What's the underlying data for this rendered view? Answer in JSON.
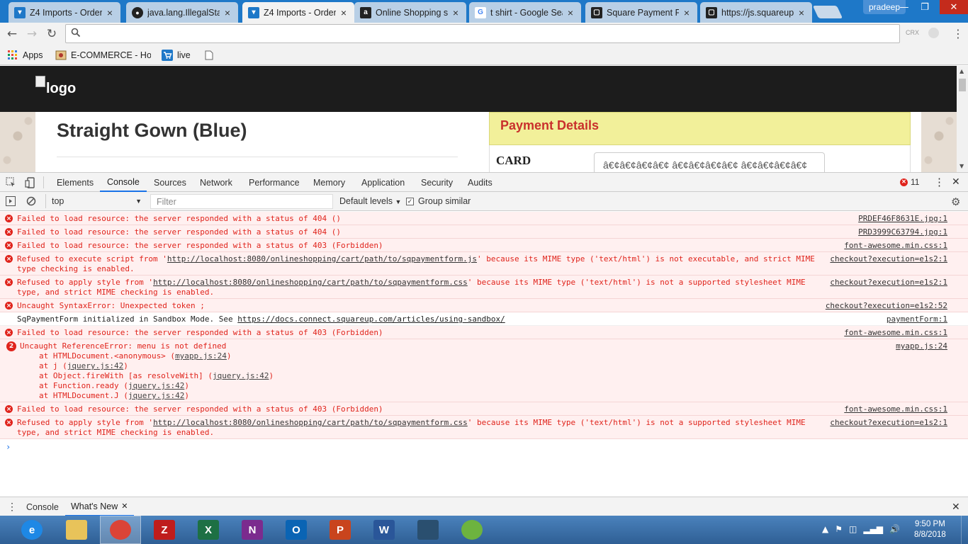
{
  "browser": {
    "tabs": [
      {
        "title": "Z4 Imports - Order",
        "icon": "cart-icon",
        "color": "#1e78c8",
        "active": false
      },
      {
        "title": "java.lang.IllegalStat",
        "icon": "github-icon",
        "color": "#222222",
        "active": false
      },
      {
        "title": "Z4 Imports - Order",
        "icon": "cart-icon",
        "color": "#1e78c8",
        "active": true
      },
      {
        "title": "Online Shopping si",
        "icon": "amazon-icon",
        "color": "#222222",
        "active": false
      },
      {
        "title": "t shirt - Google Sea",
        "icon": "google-icon",
        "color": "#ffffff",
        "active": false
      },
      {
        "title": "Square Payment Fo",
        "icon": "square-icon",
        "color": "#222222",
        "active": false
      },
      {
        "title": "https://js.squareup.",
        "icon": "square-icon",
        "color": "#222222",
        "active": false
      }
    ],
    "profile": "pradeep",
    "omnibox": {
      "value": "",
      "extension_label": "CRX"
    },
    "bookmarks": [
      {
        "label": "Apps",
        "icon": "apps-grid-icon"
      },
      {
        "label": "E-COMMERCE - Hom",
        "icon": "ecommerce-icon"
      },
      {
        "label": "live",
        "icon": "cart-icon"
      },
      {
        "label": "",
        "icon": "page-icon"
      }
    ]
  },
  "page": {
    "logo_alt": "logo",
    "product_title": "Straight Gown (Blue)",
    "payment": {
      "title": "Payment Details",
      "card_label": "CARD",
      "card_value": "â€¢â€¢â€¢â€¢ â€¢â€¢â€¢â€¢ â€¢â€¢â€¢â€¢"
    }
  },
  "devtools": {
    "tabs": [
      "Elements",
      "Console",
      "Sources",
      "Network",
      "Performance",
      "Memory",
      "Application",
      "Security",
      "Audits"
    ],
    "active_tab": "Console",
    "error_count": "11",
    "context": "top",
    "filter_placeholder": "Filter",
    "levels": "Default levels",
    "group_similar": "Group similar",
    "messages": [
      {
        "type": "error",
        "text": "Failed to load resource: the server responded with a status of 404 ()",
        "source": "PRDEF46F8631E.jpg:1"
      },
      {
        "type": "error",
        "text": "Failed to load resource: the server responded with a status of 404 ()",
        "source": "PRD3999C63794.jpg:1"
      },
      {
        "type": "error",
        "text": "Failed to load resource: the server responded with a status of 403 (Forbidden)",
        "source": "font-awesome.min.css:1"
      },
      {
        "type": "error",
        "pre": "Refused to execute script from '",
        "link": "http://localhost:8080/onlineshopping/cart/path/to/sqpaymentform.js",
        "post": "' because its MIME type ('text/html') is not executable, and strict MIME\ntype checking is enabled.",
        "source": "checkout?execution=e1s2:1"
      },
      {
        "type": "error",
        "pre": "Refused to apply style from '",
        "link": "http://localhost:8080/onlineshopping/cart/path/to/sqpaymentform.css",
        "post": "' because its MIME type ('text/html') is not a supported stylesheet MIME\ntype, and strict MIME checking is enabled.",
        "source": "checkout?execution=e1s2:1"
      },
      {
        "type": "error",
        "text": "Uncaught SyntaxError: Unexpected token ;",
        "source": "checkout?execution=e1s2:52"
      },
      {
        "type": "info",
        "pre": "SqPaymentForm initialized in Sandbox Mode. See ",
        "link": "https://docs.connect.squareup.com/articles/using-sandbox/",
        "post": "",
        "source": "paymentForm:1"
      },
      {
        "type": "error",
        "text": "Failed to load resource: the server responded with a status of 403 (Forbidden)",
        "source": "font-awesome.min.css:1"
      },
      {
        "type": "error",
        "count": "2",
        "text": "Uncaught ReferenceError: menu is not defined",
        "source": "myapp.js:24",
        "stack": [
          {
            "pre": "at HTMLDocument.<anonymous> (",
            "link": "myapp.js:24",
            "post": ")"
          },
          {
            "pre": "at j (",
            "link": "jquery.js:42",
            "post": ")"
          },
          {
            "pre": "at Object.fireWith [as resolveWith] (",
            "link": "jquery.js:42",
            "post": ")"
          },
          {
            "pre": "at Function.ready (",
            "link": "jquery.js:42",
            "post": ")"
          },
          {
            "pre": "at HTMLDocument.J (",
            "link": "jquery.js:42",
            "post": ")"
          }
        ]
      },
      {
        "type": "error",
        "text": "Failed to load resource: the server responded with a status of 403 (Forbidden)",
        "source": "font-awesome.min.css:1"
      },
      {
        "type": "error",
        "pre": "Refused to apply style from '",
        "link": "http://localhost:8080/onlineshopping/cart/path/to/sqpaymentform.css",
        "post": "' because its MIME type ('text/html') is not a supported stylesheet MIME\ntype, and strict MIME checking is enabled.",
        "source": "checkout?execution=e1s2:1"
      }
    ],
    "prompt": "›",
    "drawer_tabs": [
      "Console",
      "What's New"
    ]
  },
  "taskbar": {
    "apps": [
      {
        "name": "ie-icon",
        "label": "e",
        "color": "#1e88e5"
      },
      {
        "name": "explorer-icon",
        "label": "",
        "color": "#e8c35a"
      },
      {
        "name": "chrome-icon",
        "label": "",
        "color": "#db4437"
      },
      {
        "name": "filezilla-icon",
        "label": "Z",
        "color": "#bf1d1d"
      },
      {
        "name": "excel-icon",
        "label": "X",
        "color": "#1d7044"
      },
      {
        "name": "onenote-icon",
        "label": "N",
        "color": "#7b2b8e"
      },
      {
        "name": "outlook-icon",
        "label": "O",
        "color": "#0a64b4"
      },
      {
        "name": "powerpoint-icon",
        "label": "P",
        "color": "#c9441d"
      },
      {
        "name": "word-icon",
        "label": "W",
        "color": "#2a5699"
      },
      {
        "name": "mysql-workbench-icon",
        "label": "",
        "color": "#2a4f6f"
      },
      {
        "name": "spring-tool-suite-icon",
        "label": "",
        "color": "#6db33f"
      }
    ],
    "time": "9:50 PM",
    "date": "8/8/2018"
  }
}
